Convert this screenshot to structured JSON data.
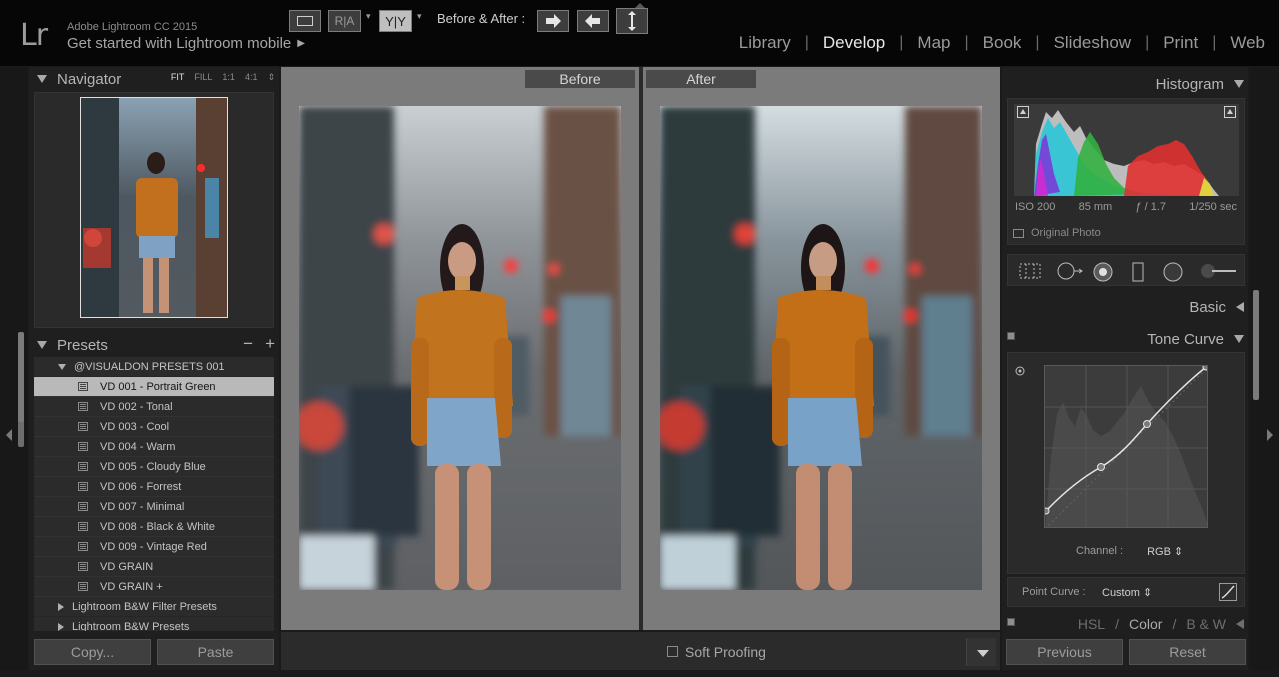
{
  "app": {
    "logo": "Lr",
    "version": "Adobe Lightroom CC 2015",
    "mobile_link": "Get started with Lightroom mobile",
    "mobile_arrow": "▶"
  },
  "modules": {
    "library": "Library",
    "develop": "Develop",
    "map": "Map",
    "book": "Book",
    "slideshow": "Slideshow",
    "print": "Print",
    "web": "Web",
    "separator": "|",
    "active": "Develop"
  },
  "navigator": {
    "title": "Navigator",
    "zoom_fit": "FIT",
    "zoom_fill": "FILL",
    "zoom_1_1": "1:1",
    "zoom_4_1": "4:1",
    "zoom_spinner": "⇕"
  },
  "presets": {
    "title": "Presets",
    "minus": "−",
    "plus": "+",
    "folder_open": "@VISUALDON PRESETS 001",
    "items": [
      "VD 001 - Portrait Green",
      "VD 002 - Tonal",
      "VD 003 - Cool",
      "VD 004 - Warm",
      "VD 005 - Cloudy Blue",
      "VD 006 - Forrest",
      "VD 007 - Minimal",
      "VD 008 - Black & White",
      "VD 009 - Vintage Red",
      "VD GRAIN",
      "VD GRAIN +"
    ],
    "selected_index": 0,
    "folder_bw_filter": "Lightroom B&W Filter Presets",
    "folder_bw": "Lightroom B&W Presets"
  },
  "left_buttons": {
    "copy": "Copy...",
    "paste": "Paste"
  },
  "view": {
    "before_label": "Before",
    "after_label": "After"
  },
  "toolbar": {
    "ra_label": "R|A",
    "yy_label": "Y|Y",
    "before_after_label": "Before & After :",
    "soft_proofing": "Soft Proofing"
  },
  "histogram": {
    "title": "Histogram",
    "iso": "ISO 200",
    "focal": "85 mm",
    "aperture": "ƒ / 1.7",
    "shutter": "1/250 sec",
    "original_photo": "Original Photo"
  },
  "basic": {
    "title": "Basic"
  },
  "tone_curve": {
    "title": "Tone Curve",
    "channel_label": "Channel :",
    "channel_value": "RGB ⇕",
    "point_curve_label": "Point Curve :",
    "point_curve_value": "Custom ⇕"
  },
  "hsl": {
    "hsl": "HSL",
    "slash": "/",
    "color": "Color",
    "bw": "B & W"
  },
  "right_buttons": {
    "previous": "Previous",
    "reset": "Reset"
  },
  "colors": {
    "accent_selected": "#b9b9b9",
    "panel_bg": "#1f1f1f",
    "center_bg": "#7b7b7b"
  }
}
